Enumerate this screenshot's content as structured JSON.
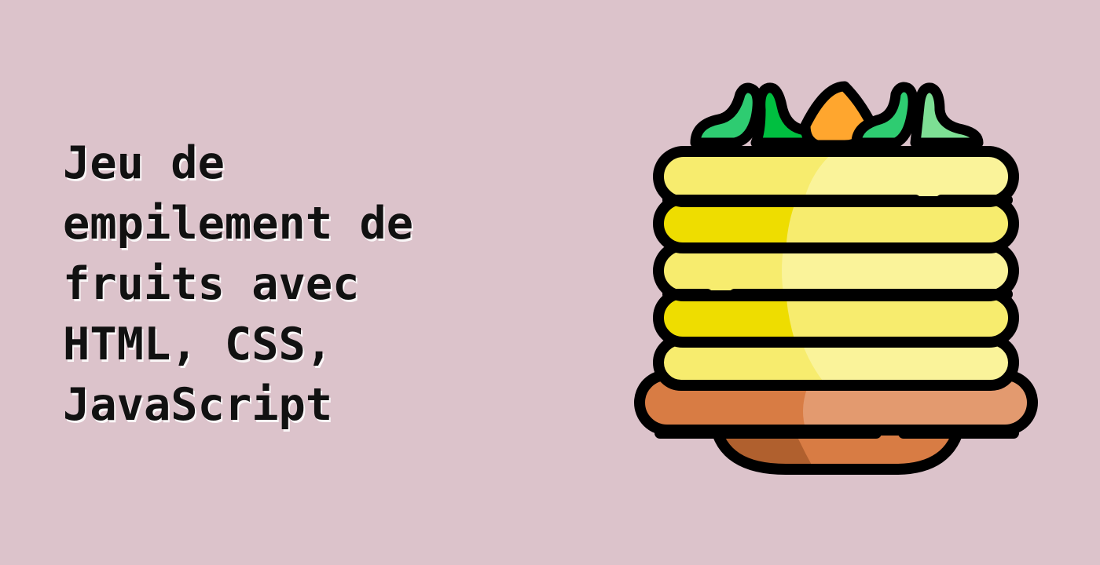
{
  "title_lines": [
    "Jeu de",
    "empilement de",
    "fruits avec",
    "HTML, CSS,",
    "JavaScript"
  ],
  "illustration": {
    "icon": "pancake-stack-icon",
    "colors": {
      "background": "#dcc3cb",
      "outline": "#000000",
      "pancake_light": "#f7ec6e",
      "pancake_shadow": "#eedd00",
      "pancake_highlight": "#faf39a",
      "plate": "#d87c44",
      "plate_highlight": "#e39a6f",
      "plate_shadow": "#b0602e",
      "leaf_dark": "#00bf40",
      "leaf_mid": "#2ecc71",
      "leaf_light": "#7ddf94",
      "fruit": "#ffa62e",
      "fruit_light": "#ffb95e"
    }
  }
}
